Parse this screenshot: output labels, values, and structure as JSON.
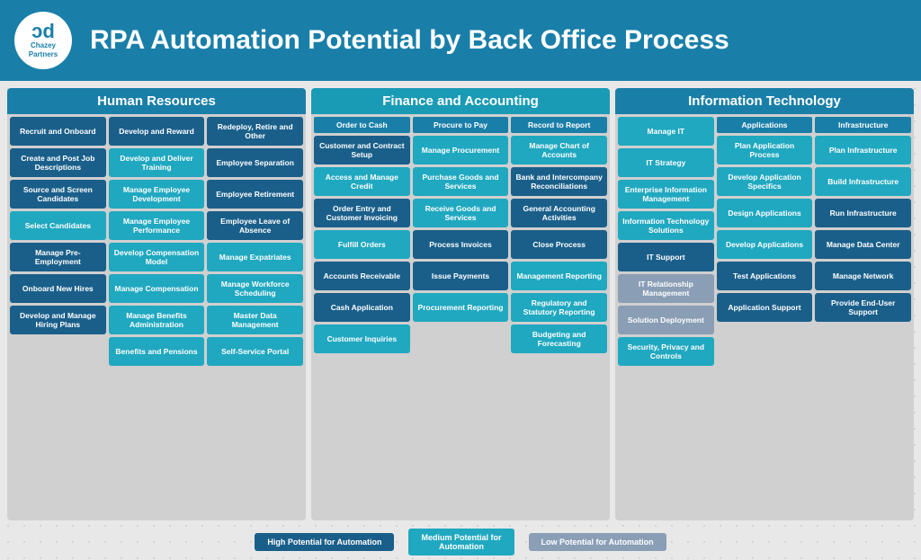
{
  "header": {
    "title": "RPA Automation Potential by Back Office Process",
    "logo_top": "Ↄd",
    "logo_bottom": "Chazey\nPartners"
  },
  "sections": {
    "hr": {
      "title": "Human Resources",
      "cols": [
        {
          "items": [
            {
              "label": "Recruit and Onboard",
              "level": "high"
            },
            {
              "label": "Create and Post Job Descriptions",
              "level": "high"
            },
            {
              "label": "Source and Screen Candidates",
              "level": "high"
            },
            {
              "label": "Select Candidates",
              "level": "medium"
            },
            {
              "label": "Manage Pre-Employment",
              "level": "high"
            },
            {
              "label": "Onboard New Hires",
              "level": "high"
            },
            {
              "label": "Develop and Manage Hiring Plans",
              "level": "high"
            }
          ]
        },
        {
          "items": [
            {
              "label": "Develop and Reward",
              "level": "high"
            },
            {
              "label": "Develop and Deliver Training",
              "level": "medium"
            },
            {
              "label": "Manage Employee Development",
              "level": "medium"
            },
            {
              "label": "Manage Employee Performance",
              "level": "medium"
            },
            {
              "label": "Develop Compensation Model",
              "level": "medium"
            },
            {
              "label": "Manage Compensation",
              "level": "medium"
            },
            {
              "label": "Manage Benefits Administration",
              "level": "medium"
            },
            {
              "label": "Benefits and Pensions",
              "level": "medium"
            }
          ]
        },
        {
          "items": [
            {
              "label": "Redeploy, Retire and Other",
              "level": "high"
            },
            {
              "label": "Employee Separation",
              "level": "high"
            },
            {
              "label": "Employee Retirement",
              "level": "high"
            },
            {
              "label": "Employee Leave of Absence",
              "level": "high"
            },
            {
              "label": "Manage Expatriates",
              "level": "medium"
            },
            {
              "label": "Manage Workforce Scheduling",
              "level": "medium"
            },
            {
              "label": "Master Data Management",
              "level": "medium"
            },
            {
              "label": "Self-Service Portal",
              "level": "medium"
            }
          ]
        }
      ]
    },
    "fa": {
      "title": "Finance and Accounting",
      "cols": [
        {
          "header": "Order to Cash",
          "items": [
            {
              "label": "Customer and Contract Setup",
              "level": "high"
            },
            {
              "label": "Access and Manage Credit",
              "level": "medium"
            },
            {
              "label": "Order Entry and Customer Invoicing",
              "level": "high"
            },
            {
              "label": "Fulfill Orders",
              "level": "medium"
            },
            {
              "label": "Accounts Receivable",
              "level": "high"
            },
            {
              "label": "Cash Application",
              "level": "high"
            },
            {
              "label": "Customer Inquiries",
              "level": "medium"
            }
          ]
        },
        {
          "header": "Procure to Pay",
          "items": [
            {
              "label": "Manage Procurement",
              "level": "medium"
            },
            {
              "label": "Purchase Goods and Services",
              "level": "medium"
            },
            {
              "label": "Receive Goods and Services",
              "level": "medium"
            },
            {
              "label": "Process Invoices",
              "level": "high"
            },
            {
              "label": "Issue Payments",
              "level": "high"
            },
            {
              "label": "Procurement Reporting",
              "level": "medium"
            }
          ]
        },
        {
          "header": "Record to Report",
          "items": [
            {
              "label": "Manage Chart of Accounts",
              "level": "medium"
            },
            {
              "label": "Bank and Intercompany Reconciliations",
              "level": "high"
            },
            {
              "label": "General Accounting Activities",
              "level": "high"
            },
            {
              "label": "Close Process",
              "level": "high"
            },
            {
              "label": "Management Reporting",
              "level": "medium"
            },
            {
              "label": "Regulatory and Statutory Reporting",
              "level": "medium"
            },
            {
              "label": "Budgeting and Forecasting",
              "level": "medium"
            }
          ]
        }
      ]
    },
    "it": {
      "title": "Information Technology",
      "cols": [
        {
          "items": [
            {
              "label": "Manage IT",
              "level": "medium"
            },
            {
              "label": "IT Strategy",
              "level": "medium"
            },
            {
              "label": "Enterprise Information Management",
              "level": "medium"
            },
            {
              "label": "Information Technology Solutions",
              "level": "medium"
            },
            {
              "label": "IT Support",
              "level": "high"
            },
            {
              "label": "IT Relationship Management",
              "level": "low"
            },
            {
              "label": "Solution Deployment",
              "level": "low"
            },
            {
              "label": "Security, Privacy and Controls",
              "level": "medium"
            }
          ]
        },
        {
          "header": "Applications",
          "items": [
            {
              "label": "Plan Application Process",
              "level": "medium"
            },
            {
              "label": "Develop Application Specifics",
              "level": "medium"
            },
            {
              "label": "Design Applications",
              "level": "medium"
            },
            {
              "label": "Develop Applications",
              "level": "medium"
            },
            {
              "label": "Test Applications",
              "level": "high"
            },
            {
              "label": "Application Support",
              "level": "high"
            }
          ]
        },
        {
          "header": "Infrastructure",
          "items": [
            {
              "label": "Plan Infrastructure",
              "level": "medium"
            },
            {
              "label": "Build Infrastructure",
              "level": "medium"
            },
            {
              "label": "Run Infrastructure",
              "level": "high"
            },
            {
              "label": "Manage Data Center",
              "level": "high"
            },
            {
              "label": "Manage Network",
              "level": "high"
            },
            {
              "label": "Provide End-User Support",
              "level": "high"
            }
          ]
        }
      ]
    }
  },
  "legend": {
    "high": "High Potential for Automation",
    "medium": "Medium Potential for\nAutomation",
    "low": "Low Potential for Automation"
  }
}
